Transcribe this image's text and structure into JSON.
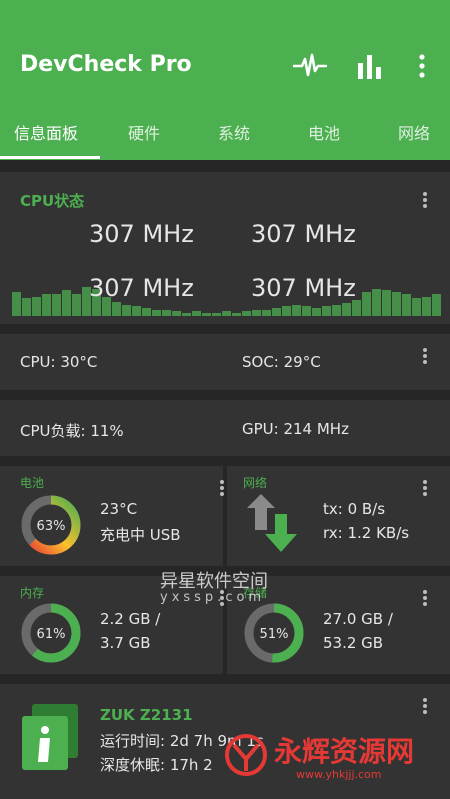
{
  "app": {
    "title": "DevCheck Pro",
    "accent": "#4caf50",
    "icons": [
      "pulse-icon",
      "bar-chart-icon",
      "more-vert-icon"
    ]
  },
  "tabs": [
    {
      "label": "信息面板",
      "active": true
    },
    {
      "label": "硬件"
    },
    {
      "label": "系统"
    },
    {
      "label": "电池"
    },
    {
      "label": "网络"
    }
  ],
  "cpu_status": {
    "title": "CPU状态",
    "cores": [
      "307 MHz",
      "307 MHz",
      "307 MHz",
      "307 MHz"
    ],
    "history_levels": [
      0.75,
      0.55,
      0.6,
      0.7,
      0.7,
      0.8,
      0.7,
      0.9,
      0.85,
      0.6,
      0.45,
      0.35,
      0.3,
      0.25,
      0.2,
      0.2,
      0.15,
      0.1,
      0.15,
      0.1,
      0.1,
      0.15,
      0.1,
      0.15,
      0.2,
      0.2,
      0.25,
      0.3,
      0.35,
      0.3,
      0.25,
      0.3,
      0.35,
      0.4,
      0.5,
      0.75,
      0.85,
      0.8,
      0.75,
      0.7,
      0.55,
      0.6,
      0.7
    ]
  },
  "temps": {
    "cpu": "CPU: 30°C",
    "soc": "SOC: 29°C"
  },
  "load": {
    "cpu": "CPU负载: 11%",
    "gpu": "GPU: 214 MHz"
  },
  "battery": {
    "title": "电池",
    "percent_label": "63%",
    "level": 0.63,
    "temp": "23°C",
    "status": "充电中 USB"
  },
  "network": {
    "title": "网络",
    "tx": "tx: 0 B/s",
    "rx": "rx: 1.2 KB/s"
  },
  "memory": {
    "title": "内存",
    "percent_label": "61%",
    "level": 0.61,
    "line1": "2.2 GB /",
    "line2": "3.7 GB"
  },
  "storage": {
    "title": "存储",
    "percent_label": "51%",
    "level": 0.51,
    "line1": "27.0 GB /",
    "line2": "53.2 GB"
  },
  "device": {
    "name": "ZUK Z2131",
    "uptime": "运行时间: 2d 7h 9m 1s",
    "deep_sleep": "深度休眠: 17h 2"
  },
  "watermarks": {
    "site_cn": "异星软件空间",
    "site_url": "yxssp.com",
    "brand": "永辉资源网",
    "brand_url": "www.yhkjjj.com"
  }
}
